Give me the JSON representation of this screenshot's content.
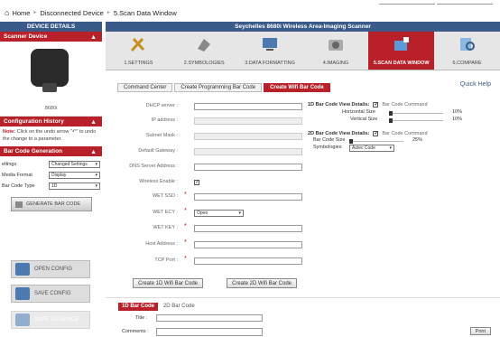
{
  "breadcrumb": {
    "home": "Home",
    "sep": "►",
    "items": [
      "Disconnected Device",
      "5.Scan Data Window"
    ]
  },
  "sidebar": {
    "device_details": "DEVICE DETAILS",
    "scanner_device": "Scanner Device",
    "device_name": "8680i",
    "config_history": "Configuration History",
    "note_label": "Note:",
    "note_text": "Click on the undo arrow \"↶\" to undo the change to a parameter.",
    "barcode_generation": "Bar Code Generation",
    "settings_label": "ettings",
    "settings_value": "Changed Settings",
    "media_label": "Media Format",
    "media_value": "Display",
    "type_label": "Bar Code Type",
    "type_value": "1D",
    "generate_btn": "GENERATE BAR CODE",
    "open_config": "OPEN CONFIG",
    "save_config": "SAVE CONFIG",
    "save_to_device": "SAVE TO DEVICE"
  },
  "main": {
    "title": "Seychelles 8680i Wireless Area-Imaging Scanner",
    "nav": [
      "1.SETTINGS",
      "2.SYMBOLOGIES",
      "3.DATA FORMATTING",
      "4.IMAGING",
      "5.SCAN DATA WINDOW",
      "6.COMPARE"
    ],
    "tabs": [
      "Command Center",
      "Create Programming Bar Code",
      "Create Wifi Bar Code"
    ],
    "quick_help": "Quick Help",
    "fields": {
      "dhcp": "DHCP server :",
      "ip": "IP address :",
      "subnet": "Subnet Mask :",
      "gateway": "Default Gateway :",
      "dns": "DNS Server Address :",
      "wireless": "Wireless Enable :",
      "ssid": "WET SSD :",
      "ecy": "WET ECY :",
      "ecy_value": "Open",
      "key": "WET KEY :",
      "host": "Host Address :",
      "port": "TCP Port :"
    },
    "req_mark": "*",
    "check_mark": "✓",
    "view1d": {
      "title": "1D Bar Code View Details:",
      "cmd": "Bar Code Command",
      "h_label": "Horizontal Size",
      "h_val": "10%",
      "v_label": "Vertical Size",
      "v_val": "10%"
    },
    "view2d": {
      "title": "2D Bar Code View Details:",
      "cmd": "Bar Code Command",
      "size_label": "Bar Code Size",
      "size_val": "25%",
      "sym_label": "Symbologies",
      "sym_value": "Aztec Code"
    },
    "btn_1d": "Create 1D Wifi Bar Code",
    "btn_2d": "Create 2D Wifi Bar Code",
    "lower_tabs": [
      "1D Bar Code",
      "2D Bar Code"
    ],
    "title_label": "Title :",
    "comments_label": "Comments :",
    "print": "Print"
  }
}
